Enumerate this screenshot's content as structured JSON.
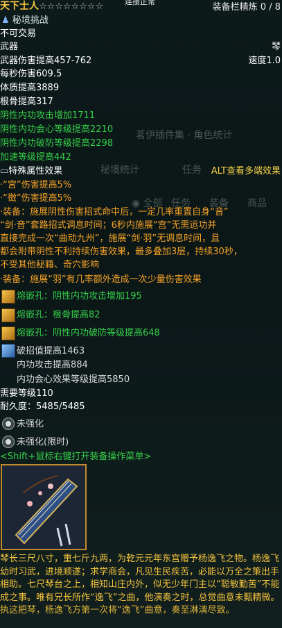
{
  "header": {
    "name": "天下士人",
    "stars": "☆☆☆☆☆☆☆☆",
    "top_note": "连接正常",
    "refine": "装备栏精炼 0 / 8"
  },
  "secret_label": "秘境挑战",
  "trade": "不可交易",
  "slot": "武器",
  "weapon_type": "琴",
  "weapon_damage": "武器伤害提高457-762",
  "speed": "速度1.0",
  "dps": "每秒伤害609.5",
  "stats": [
    "体质提高3889",
    "根骨提高317"
  ],
  "green_stats": [
    "阴性内功攻击增加1711",
    "阴性内功会心等级提高2210",
    "阴性内功破防等级提高2298",
    "加速等级提高442"
  ],
  "special_title": "特殊属性效果",
  "alt_note": "ALT查看多端效果",
  "effects": [
    "·“宫”伤害提高5%",
    "·“徵”伤害提高5%",
    "·装备：施展阴性伤害招式命中后，一定几率重置自身“音”",
    "“剑·音”套路招式调息时间；6秒内施展“宫”无需运功并",
    "直接完成一次“曲动九州”，施展“剑·羽”无调息时间，且",
    "都会附带阴性不利持续伤害效果，最多叠加3层，持续30秒，",
    "不受其他秘籍、奇穴影响",
    "·装备：施展“羽”有几率额外造成一次少量伤害效果"
  ],
  "sockets": [
    "熔嵌孔：阴性内功攻击增加195",
    "熔嵌孔：根骨提高82",
    "熔嵌孔：阴性内功破防等级提高648"
  ],
  "enchant": [
    "破招值提高1463",
    "内功攻击提高884",
    "内功会心效果等级提高5850"
  ],
  "level_req": "需要等级110",
  "durability": "耐久度：5485/5485",
  "strengthen": [
    "未强化",
    "未强化(限时)"
  ],
  "shift_hint": "<Shift+鼠标右键打开装备操作菜单>",
  "description": "琴长三尺八寸，重七斤九两，为乾元元年东宫赠予杨逸飞之物。杨逸飞幼时习武，进境顺遂；求学商会，凡见生民疾苦，必能以万全之策出手相助。七尺琴台之上，相知山庄内外，似无少年门主以“聪敏勤苦”不能成之事。唯有兄长所作“逸飞”之曲，他演奏之时，总觉曲意未甄精微。",
  "description_tail": "执这把琴，杨逸飞方第一次将“逸飞”曲意，奏至淋漓尽致。",
  "ghost": {
    "plugin": "茗伊插件集 · 角色统计",
    "tab1": "秘境统计",
    "tab2": "任务",
    "filters": [
      "全部",
      "任务",
      "装备",
      "商品"
    ]
  },
  "colors": {
    "green": "#35d04a",
    "yellow": "#f7d247",
    "orange": "#f5a327",
    "gold": "#f3b53c"
  }
}
